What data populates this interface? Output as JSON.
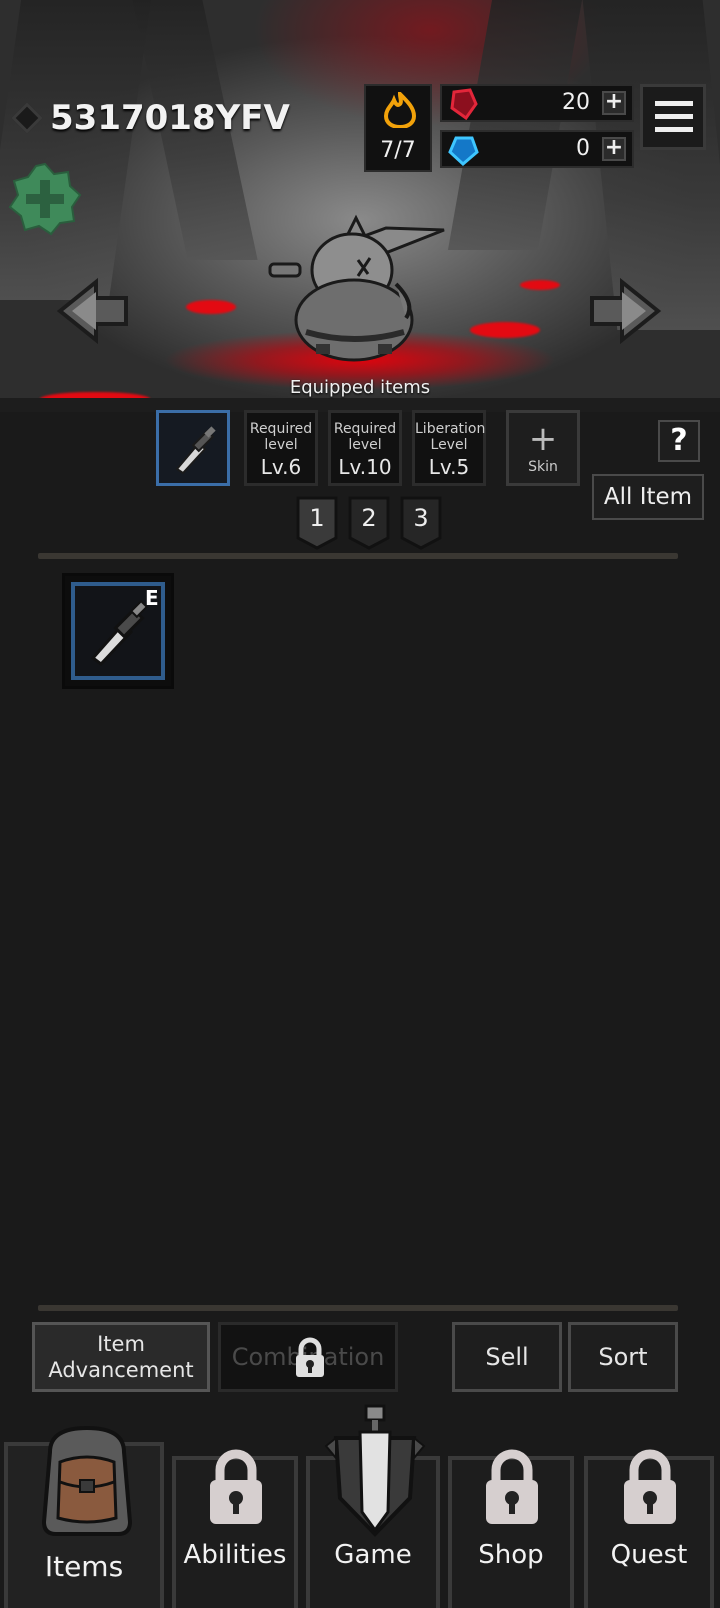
{
  "header": {
    "player_id": "5317018YFV",
    "stamina": "7/7",
    "red_gems": "20",
    "blue_gems": "0",
    "plus_symbol": "+"
  },
  "scene": {
    "equipped_label": "Equipped items"
  },
  "equip_slots": [
    {
      "line1": "",
      "level": ""
    },
    {
      "line1": "Required level",
      "level": "Lv.6"
    },
    {
      "line1": "Required level",
      "level": "Lv.10"
    },
    {
      "line1": "Liberation Level",
      "level": "Lv.5"
    }
  ],
  "skin_slot": {
    "plus": "+",
    "label": "Skin"
  },
  "help_label": "?",
  "all_item_label": "All Item",
  "pages": [
    "1",
    "2",
    "3"
  ],
  "inventory": [
    {
      "badge": "E",
      "icon": "sword-icon"
    }
  ],
  "actions": {
    "advancement": "Item Advancement",
    "combination": "Combination",
    "sell": "Sell",
    "sort": "Sort"
  },
  "nav": {
    "items": "Items",
    "abilities": "Abilities",
    "game": "Game",
    "shop": "Shop",
    "quest": "Quest"
  },
  "colors": {
    "background": "#1a1a1a",
    "blood_red": "#e30a12",
    "slot_active_border": "#3b6ea8",
    "add_badge_green": "#3f8a5a"
  }
}
